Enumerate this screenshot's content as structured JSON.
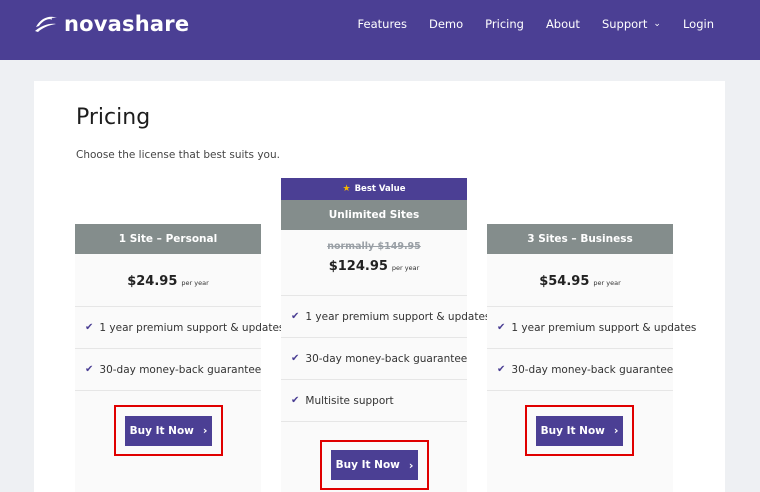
{
  "brand": {
    "name": "novashare"
  },
  "nav": {
    "items": [
      "Features",
      "Demo",
      "Pricing",
      "About",
      "Support",
      "Login"
    ]
  },
  "page": {
    "title": "Pricing",
    "subtitle": "Choose the license that best suits you."
  },
  "plans": [
    {
      "name": "1 Site – Personal",
      "price": "$24.95",
      "period": "per year",
      "features": [
        "1 year premium support & updates",
        "30-day money-back guarantee"
      ],
      "button": "Buy It Now"
    },
    {
      "badge": "Best Value",
      "name": "Unlimited Sites",
      "old_price": "normally $149.95",
      "price": "$124.95",
      "period": "per year",
      "features": [
        "1 year premium support & updates",
        "30-day money-back guarantee",
        "Multisite support"
      ],
      "button": "Buy It Now"
    },
    {
      "name": "3 Sites – Business",
      "price": "$54.95",
      "period": "per year",
      "features": [
        "1 year premium support & updates",
        "30-day money-back guarantee"
      ],
      "button": "Buy It Now"
    }
  ],
  "colors": {
    "header": "#4b3f94",
    "plan_head": "#848d8c",
    "highlight": "#e00000"
  }
}
